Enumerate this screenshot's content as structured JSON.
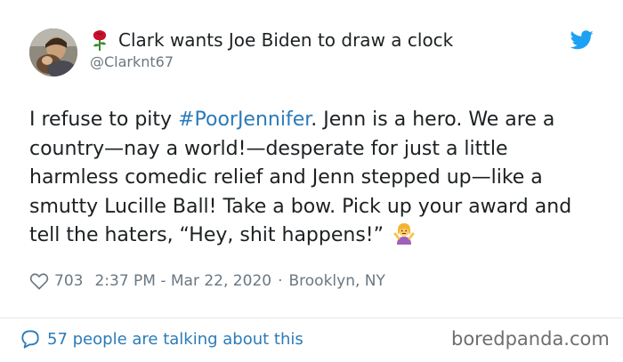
{
  "user": {
    "display_name": "Clark wants Joe Biden to draw a clock",
    "handle": "@Clarknt67",
    "name_icon": "rose-icon",
    "avatar_icon": "avatar"
  },
  "tweet": {
    "text_before_hashtag": "I refuse to pity ",
    "hashtag": "#PoorJennifer",
    "text_after_hashtag": ". Jenn is a hero. We are a country—nay a world!—desperate for just a little harmless comedic relief and Jenn stepped up—like a smutty Lucille Ball! Take a bow. Pick up your award and tell the haters, “Hey, shit happens!” ",
    "emoji_icon": "person-shrugging-emoji-icon"
  },
  "meta": {
    "likes": "703",
    "timestamp": "2:37 PM - Mar 22, 2020",
    "separator": "·",
    "location": "Brooklyn, NY"
  },
  "footer": {
    "talking": "57 people are talking about this",
    "watermark": "boredpanda.com"
  },
  "colors": {
    "link": "#2b7bb9",
    "muted": "#697882",
    "text": "#1c2022",
    "twitter_blue": "#1da1f2"
  }
}
